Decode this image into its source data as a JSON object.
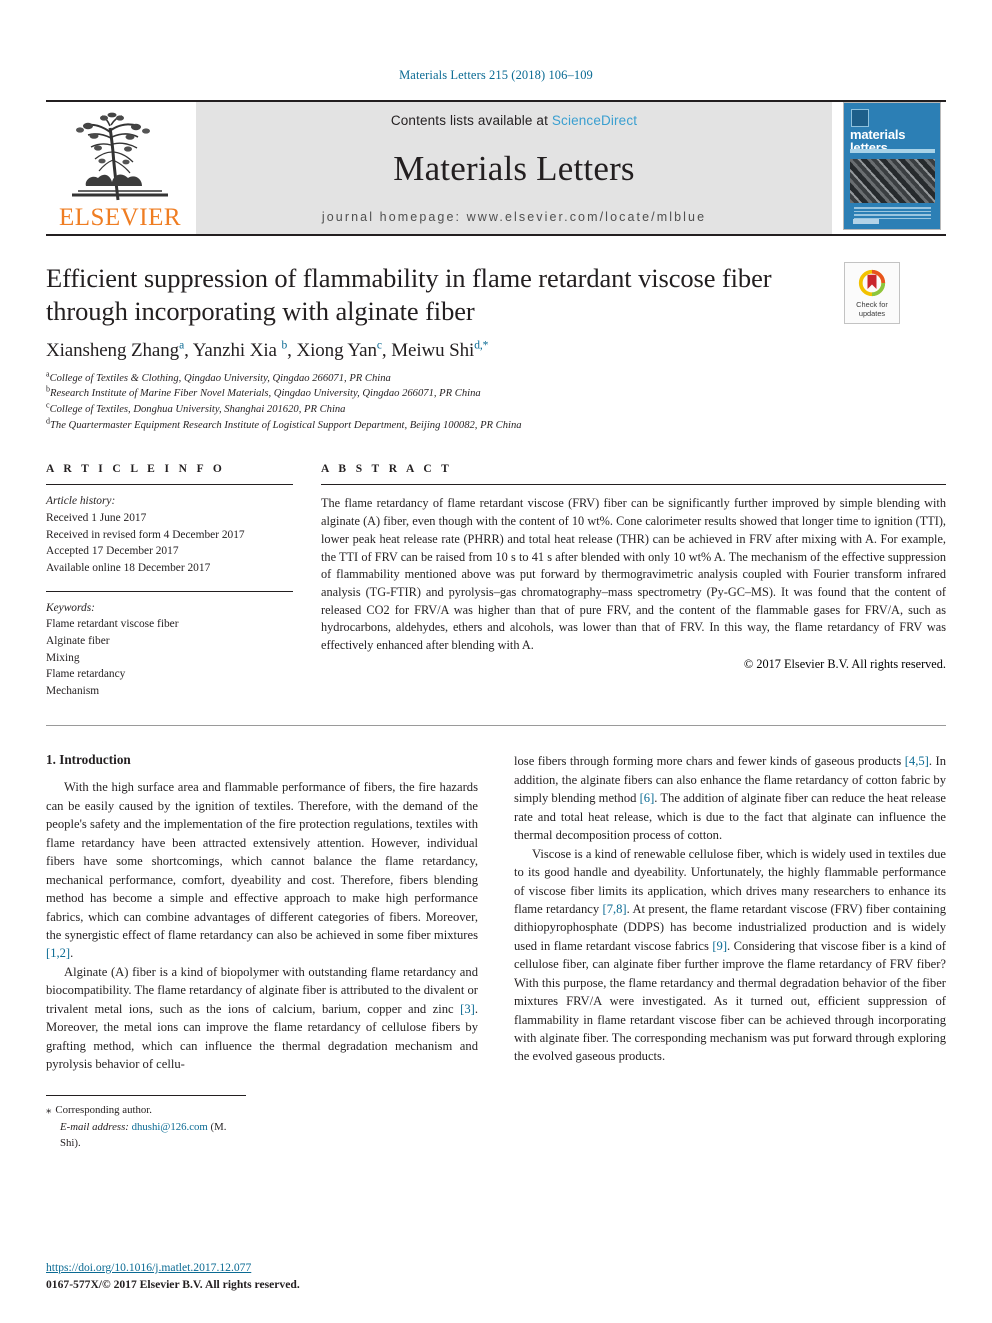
{
  "running_head": "Materials Letters 215 (2018) 106–109",
  "masthead": {
    "publisher_name": "ELSEVIER",
    "contents_prefix": "Contents lists available at ",
    "contents_link": "ScienceDirect",
    "journal_name": "Materials Letters",
    "homepage": "journal homepage: www.elsevier.com/locate/mlblue",
    "cover_title": "materials letters"
  },
  "crossmark": {
    "line1": "Check for",
    "line2": "updates"
  },
  "article": {
    "title": "Efficient suppression of flammability in flame retardant viscose fiber through incorporating with alginate fiber",
    "authors": [
      {
        "name": "Xiansheng Zhang",
        "sup": "a"
      },
      {
        "name": "Yanzhi Xia",
        "sup": "b"
      },
      {
        "name": "Xiong Yan",
        "sup": "c"
      },
      {
        "name": "Meiwu Shi",
        "sup": "d,*"
      }
    ],
    "affiliations": [
      {
        "mark": "a",
        "text": "College of Textiles & Clothing, Qingdao University, Qingdao 266071, PR China"
      },
      {
        "mark": "b",
        "text": "Research Institute of Marine Fiber Novel Materials, Qingdao University, Qingdao 266071, PR China"
      },
      {
        "mark": "c",
        "text": "College of Textiles, Donghua University, Shanghai 201620, PR China"
      },
      {
        "mark": "d",
        "text": "The Quartermaster Equipment Research Institute of Logistical Support Department, Beijing 100082, PR China"
      }
    ]
  },
  "article_info": {
    "heading": "A R T I C L E   I N F O",
    "history_label": "Article history:",
    "history": [
      "Received 1 June 2017",
      "Received in revised form 4 December 2017",
      "Accepted 17 December 2017",
      "Available online 18 December 2017"
    ],
    "keywords_label": "Keywords:",
    "keywords": [
      "Flame retardant viscose fiber",
      "Alginate fiber",
      "Mixing",
      "Flame retardancy",
      "Mechanism"
    ]
  },
  "abstract": {
    "heading": "A B S T R A C T",
    "text": "The flame retardancy of flame retardant viscose (FRV) fiber can be significantly further improved by simple blending with alginate (A) fiber, even though with the content of 10 wt%. Cone calorimeter results showed that longer time to ignition (TTI), lower peak heat release rate (PHRR) and total heat release (THR) can be achieved in FRV after mixing with A. For example, the TTI of FRV can be raised from 10 s to 41 s after blended with only 10 wt% A. The mechanism of the effective suppression of flammability mentioned above was put forward by thermogravimetric analysis coupled with Fourier transform infrared analysis (TG-FTIR) and pyrolysis–gas chromatography–mass spectrometry (Py-GC–MS). It was found that the content of released CO2 for FRV/A was higher than that of pure FRV, and the content of the flammable gases for FRV/A, such as hydrocarbons, aldehydes, ethers and alcohols, was lower than that of FRV. In this way, the flame retardancy of FRV was effectively enhanced after blending with A.",
    "copyright": "© 2017 Elsevier B.V. All rights reserved."
  },
  "body": {
    "section_heading": "1. Introduction",
    "left_paragraph_1_a": "With the high surface area and flammable performance of fibers, the fire hazards can be easily caused by the ignition of textiles. Therefore, with the demand of the people's safety and the implementation of the fire protection regulations, textiles with flame retardancy have been attracted extensively attention. However, individual fibers have some shortcomings, which cannot balance the flame retardancy, mechanical performance, comfort, dyeability and cost. Therefore, fibers blending method has become a simple and effective approach to make high performance fabrics, which can combine advantages of different categories of fibers. Moreover, the synergistic effect of flame retardancy can also be achieved in some fiber mixtures ",
    "ref_1_2": "[1,2]",
    "left_paragraph_1_b": ".",
    "left_paragraph_2_a": "Alginate (A) fiber is a kind of biopolymer with outstanding flame retardancy and biocompatibility. The flame retardancy of alginate fiber is attributed to the divalent or trivalent metal ions, such as the ions of calcium, barium, copper and zinc ",
    "ref_3": "[3]",
    "left_paragraph_2_b": ". Moreover, the metal ions can improve the flame retardancy of cellulose fibers by grafting method, which can influence the thermal degradation mechanism and pyrolysis behavior of cellu-",
    "right_paragraph_1_a": "lose fibers through forming more chars and fewer kinds of gaseous products ",
    "ref_4_5": "[4,5]",
    "right_paragraph_1_b": ". In addition, the alginate fibers can also enhance the flame retardancy of cotton fabric by simply blending method ",
    "ref_6": "[6]",
    "right_paragraph_1_c": ". The addition of alginate fiber can reduce the heat release rate and total heat release, which is due to the fact that alginate can influence the thermal decomposition process of cotton.",
    "right_paragraph_2_a": "Viscose is a kind of renewable cellulose fiber, which is widely used in textiles due to its good handle and dyeability. Unfortunately, the highly flammable performance of viscose fiber limits its application, which drives many researchers to enhance its flame retardancy ",
    "ref_7_8": "[7,8]",
    "right_paragraph_2_b": ". At present, the flame retardant viscose (FRV) fiber containing dithiopyrophosphate (DDPS) has become industrialized production and is widely used in flame retardant viscose fabrics ",
    "ref_9": "[9]",
    "right_paragraph_2_c": ". Considering that viscose fiber is a kind of cellulose fiber, can alginate fiber further improve the flame retardancy of FRV fiber? With this purpose, the flame retardancy and thermal degradation behavior of the fiber mixtures FRV/A were investigated. As it turned out, efficient suppression of flammability in flame retardant viscose fiber can be achieved through incorporating with alginate fiber. The corresponding mechanism was put forward through exploring the evolved gaseous products."
  },
  "footnote": {
    "star": "⁎",
    "corresponding": "Corresponding author.",
    "email_label": "E-mail address:",
    "email": "dhushi@126.com",
    "email_suffix": "(M. Shi)."
  },
  "page_footer": {
    "doi": "https://doi.org/10.1016/j.matlet.2017.12.077",
    "issn": "0167-577X/© 2017 Elsevier B.V. All rights reserved."
  },
  "colors": {
    "link_blue": "#0a6a93",
    "sciencedirect_blue": "#3a9fd0",
    "elsevier_orange": "#ef7d22",
    "cover_blue": "#2c7fb5"
  }
}
